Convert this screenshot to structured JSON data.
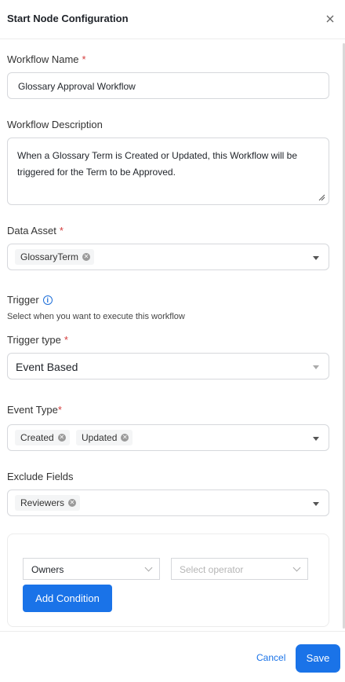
{
  "header": {
    "title": "Start Node Configuration"
  },
  "workflow_name": {
    "label": "Workflow Name",
    "required": "*",
    "value": "Glossary Approval Workflow"
  },
  "workflow_description": {
    "label": "Workflow Description",
    "value": "When a Glossary Term is Created or Updated, this Workflow will be triggered for the Term to be Approved."
  },
  "data_asset": {
    "label": "Data Asset",
    "required": "*",
    "tags": [
      "GlossaryTerm"
    ]
  },
  "trigger": {
    "title": "Trigger",
    "help": "Select when you want to execute this workflow",
    "type_label": "Trigger type",
    "required": "*",
    "type_value": "Event Based"
  },
  "event_type": {
    "label": "Event Type",
    "required": "*",
    "tags": [
      "Created",
      "Updated"
    ]
  },
  "exclude_fields": {
    "label": "Exclude Fields",
    "tags": [
      "Reviewers"
    ]
  },
  "condition": {
    "field_value": "Owners",
    "operator_placeholder": "Select operator",
    "add_label": "Add Condition"
  },
  "footer": {
    "cancel_label": "Cancel",
    "save_label": "Save"
  },
  "colors": {
    "primary": "#1a73e8",
    "required": "#d43c3c"
  },
  "icons": {
    "close": "close-icon",
    "info": "info-icon",
    "tag_remove": "tag-remove-icon"
  }
}
